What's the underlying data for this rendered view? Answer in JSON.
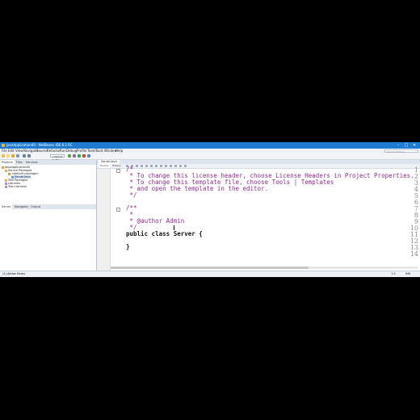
{
  "window": {
    "title": "JavaApplication40 - NetBeans IDE 8.2 RC",
    "controls": [
      "–",
      "□",
      "✕"
    ]
  },
  "menu": [
    "File",
    "Edit",
    "View",
    "Navigate",
    "Source",
    "Refactor",
    "Run",
    "Debug",
    "Profile",
    "Team",
    "Tools",
    "Window",
    "Help"
  ],
  "search": {
    "placeholder": "Search (Ctrl+I)"
  },
  "toolbar": {
    "config": "<default config>"
  },
  "project_panel": {
    "tabs": [
      "Projects",
      "Files",
      "Services"
    ],
    "tree": [
      "JavaApplication40",
      "Source Packages",
      "<default package>",
      "Server.java",
      "Test Packages",
      "Libraries",
      "Test Libraries"
    ]
  },
  "navigator_panel": {
    "tabs": [
      "Server",
      "Navigator",
      "Output"
    ]
  },
  "editor": {
    "file_tab": "Server.java",
    "subtabs": [
      "Source",
      "History"
    ],
    "lines": [
      {
        "n": "1",
        "text": "/*"
      },
      {
        "n": "2",
        "text": " * To change this license header, choose License Headers in Project Properties."
      },
      {
        "n": "3",
        "text": " * To change this template file, choose Tools | Templates"
      },
      {
        "n": "4",
        "text": " * and open the template in the editor."
      },
      {
        "n": "5",
        "text": " */"
      },
      {
        "n": "6",
        "text": ""
      },
      {
        "n": "7",
        "text": "/**"
      },
      {
        "n": "8",
        "text": " *"
      },
      {
        "n": "9",
        "text": " * @author Admin"
      },
      {
        "n": "10",
        "text": " */"
      },
      {
        "n": "11",
        "text": "public class Server {"
      },
      {
        "n": "12",
        "text": ""
      },
      {
        "n": "13",
        "text": "}"
      },
      {
        "n": "14",
        "text": ""
      }
    ]
  },
  "status": {
    "left": "(1) Action Items",
    "right": "1:1",
    "mode": "INS"
  },
  "colors": {
    "titlebar": "#1e7bd2",
    "comment": "#8e2c8e",
    "keyword": "#111111"
  }
}
